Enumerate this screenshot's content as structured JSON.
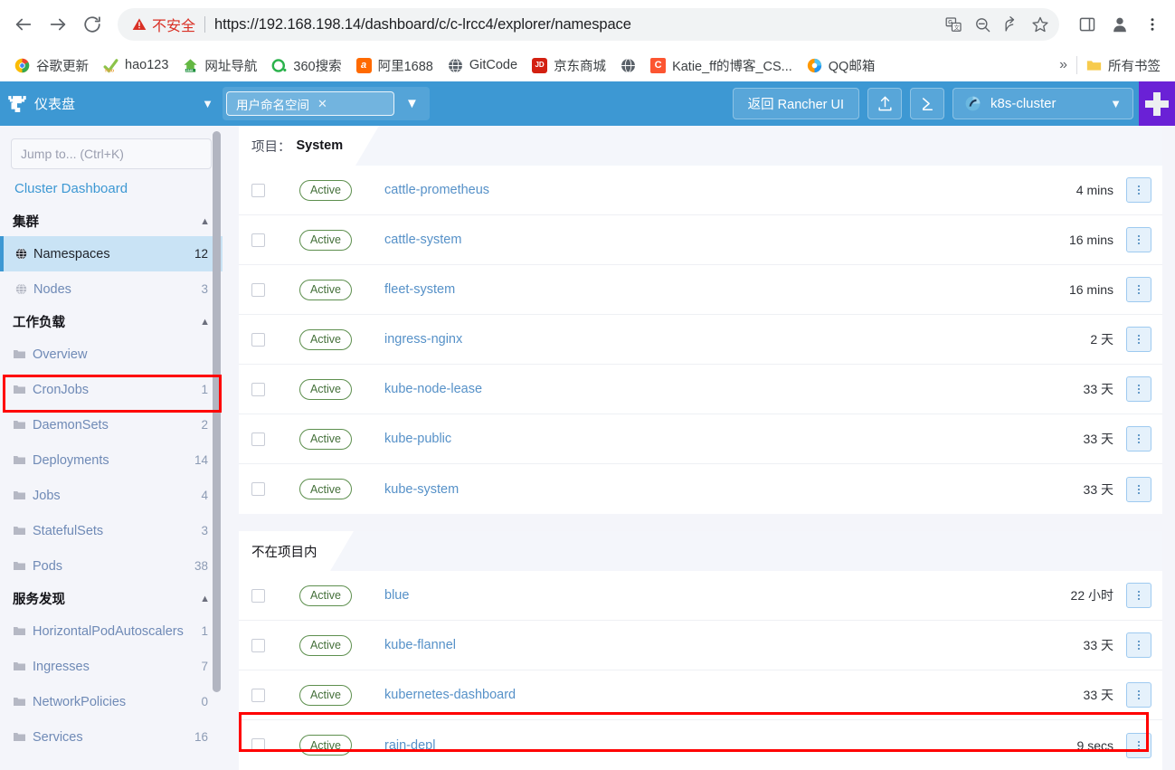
{
  "browser": {
    "nav": {
      "back_icon": "back-arrow-icon",
      "forward_icon": "forward-arrow-icon",
      "reload_icon": "reload-icon"
    },
    "omnibox": {
      "security_warning": "不安全",
      "url": "https://192.168.198.14/dashboard/c/c-lrcc4/explorer/namespace",
      "icons": [
        "translate-icon",
        "zoom-out-icon",
        "share-icon",
        "bookmark-star-icon"
      ]
    },
    "toolbar_right": [
      "side-panel-icon",
      "profile-icon",
      "chrome-menu-icon"
    ],
    "bookmarks": [
      {
        "label": "谷歌更新",
        "icon": "chrome-icon",
        "color": "#ffffff"
      },
      {
        "label": "hao123",
        "icon": "hao123-icon",
        "color": "#ffffff"
      },
      {
        "label": "网址导航",
        "icon": "2345-icon",
        "color": "#ffffff"
      },
      {
        "label": "360搜索",
        "icon": "360-icon",
        "color": "#ffffff"
      },
      {
        "label": "阿里1688",
        "icon": "alibaba-icon",
        "color": "#ff6a00"
      },
      {
        "label": "GitCode",
        "icon": "gitcode-icon",
        "color": "#5a6169"
      },
      {
        "label": "京东商城",
        "icon": "jd-icon",
        "color": "#d32011"
      },
      {
        "label": "Katie_ff的博客_CS...",
        "icon": "csdn-icon",
        "color": "#fc5531"
      },
      {
        "label": "QQ邮箱",
        "icon": "qqmail-icon",
        "color": "#ffffff"
      }
    ],
    "bookmarks_overflow": "»",
    "all_bookmarks_label": "所有书签"
  },
  "app_header": {
    "logo_icon": "rancher-logo-icon",
    "title": "仪表盘",
    "title_caret_icon": "chevron-down-icon",
    "namespace_filter": {
      "label": "用户命名空间",
      "remove_icon": "x-icon",
      "caret_icon": "chevron-down-icon"
    },
    "back_to_rancher_label": "返回 Rancher UI",
    "import_yaml_icon": "upload-icon",
    "shell_icon": "terminal-icon",
    "cluster": {
      "icon": "cluster-icon",
      "name": "k8s-cluster",
      "caret_icon": "chevron-down-icon"
    },
    "extension_tile_icon": "plus-tile-icon",
    "accent_color": "#3d98d3"
  },
  "sidebar": {
    "search_placeholder": "Jump to... (Ctrl+K)",
    "cluster_dashboard_label": "Cluster Dashboard",
    "groups": [
      {
        "label": "集群",
        "collapse_icon": "chevron-up-icon",
        "items": [
          {
            "label": "Namespaces",
            "count": "12",
            "icon": "globe-icon",
            "active": true
          },
          {
            "label": "Nodes",
            "count": "3",
            "icon": "globe-icon",
            "active": false
          }
        ]
      },
      {
        "label": "工作负载",
        "collapse_icon": "chevron-up-icon",
        "items": [
          {
            "label": "Overview",
            "count": "",
            "icon": "folder-icon",
            "active": false
          },
          {
            "label": "CronJobs",
            "count": "1",
            "icon": "folder-icon",
            "active": false
          },
          {
            "label": "DaemonSets",
            "count": "2",
            "icon": "folder-icon",
            "active": false
          },
          {
            "label": "Deployments",
            "count": "14",
            "icon": "folder-icon",
            "active": false
          },
          {
            "label": "Jobs",
            "count": "4",
            "icon": "folder-icon",
            "active": false
          },
          {
            "label": "StatefulSets",
            "count": "3",
            "icon": "folder-icon",
            "active": false
          },
          {
            "label": "Pods",
            "count": "38",
            "icon": "folder-icon",
            "active": false
          }
        ]
      },
      {
        "label": "服务发现",
        "collapse_icon": "chevron-up-icon",
        "items": [
          {
            "label": "HorizontalPodAutoscalers",
            "count": "1",
            "icon": "folder-icon",
            "active": false
          },
          {
            "label": "Ingresses",
            "count": "7",
            "icon": "folder-icon",
            "active": false
          },
          {
            "label": "NetworkPolicies",
            "count": "0",
            "icon": "folder-icon",
            "active": false
          },
          {
            "label": "Services",
            "count": "16",
            "icon": "folder-icon",
            "active": false
          }
        ]
      }
    ]
  },
  "main": {
    "groups": [
      {
        "header_key": "项目：",
        "header_value": "System",
        "rows": [
          {
            "state": "Active",
            "name": "cattle-prometheus",
            "age": "4 mins",
            "highlighted": false
          },
          {
            "state": "Active",
            "name": "cattle-system",
            "age": "16 mins",
            "highlighted": false
          },
          {
            "state": "Active",
            "name": "fleet-system",
            "age": "16 mins",
            "highlighted": false
          },
          {
            "state": "Active",
            "name": "ingress-nginx",
            "age": "2 天",
            "highlighted": false
          },
          {
            "state": "Active",
            "name": "kube-node-lease",
            "age": "33 天",
            "highlighted": false
          },
          {
            "state": "Active",
            "name": "kube-public",
            "age": "33 天",
            "highlighted": false
          },
          {
            "state": "Active",
            "name": "kube-system",
            "age": "33 天",
            "highlighted": false
          }
        ]
      },
      {
        "header_key": "不在项目内",
        "header_value": "",
        "rows": [
          {
            "state": "Active",
            "name": "blue",
            "age": "22 小时",
            "highlighted": false
          },
          {
            "state": "Active",
            "name": "kube-flannel",
            "age": "33 天",
            "highlighted": false
          },
          {
            "state": "Active",
            "name": "kubernetes-dashboard",
            "age": "33 天",
            "highlighted": false
          },
          {
            "state": "Active",
            "name": "rain-depl",
            "age": "9 secs",
            "highlighted": true
          }
        ]
      }
    ],
    "row_menu_icon": "kebab-menu-icon",
    "highlight_color": "#ff0000"
  }
}
